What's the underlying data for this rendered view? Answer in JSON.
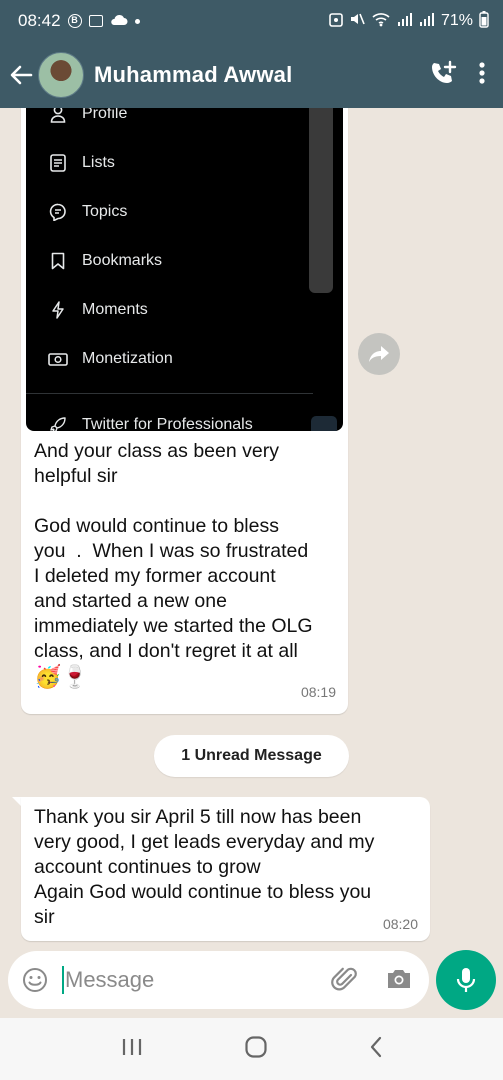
{
  "status_bar": {
    "time": "08:42",
    "battery": "71%"
  },
  "header": {
    "contact_name": "Muhammad Awwal"
  },
  "shared_screenshot": {
    "menu_items": [
      {
        "label": "Profile",
        "icon": "person-icon"
      },
      {
        "label": "Lists",
        "icon": "list-icon"
      },
      {
        "label": "Topics",
        "icon": "topics-icon"
      },
      {
        "label": "Bookmarks",
        "icon": "bookmark-icon"
      },
      {
        "label": "Moments",
        "icon": "lightning-icon"
      },
      {
        "label": "Monetization",
        "icon": "money-icon"
      },
      {
        "label": "Twitter for Professionals",
        "icon": "rocket-icon"
      }
    ]
  },
  "messages": [
    {
      "text": "And your class as been very\nhelpful sir\n\nGod would continue to bless\nyou  .  When I was so frustrated\nI deleted my former account\nand started a new one\nimmediately we started the OLG\nclass, and I don't regret it at all",
      "emojis": "🥳🍷",
      "time": "08:19"
    },
    {
      "text": "Thank you sir April 5 till now has been\nvery good, I get leads everyday and my\naccount continues to grow\nAgain God would continue to bless you\nsir",
      "time": "08:20"
    }
  ],
  "unread_banner": "1 Unread Message",
  "composer": {
    "placeholder": "Message"
  },
  "colors": {
    "header_bg": "#3e5a66",
    "chat_bg": "#ece5dd",
    "accent": "#00a884"
  }
}
